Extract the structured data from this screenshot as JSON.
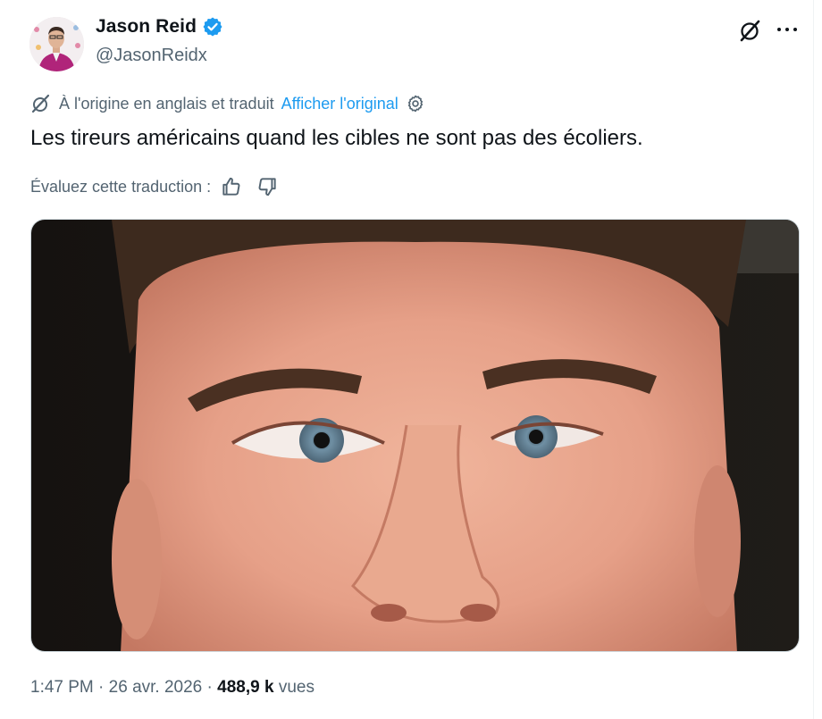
{
  "author": {
    "name": "Jason Reid",
    "handle": "@JasonReidx",
    "verified": true,
    "verified_color": "#1d9bf0"
  },
  "translation": {
    "notice": "À l'origine en anglais et traduit",
    "show_original": "Afficher l'original",
    "rate_label": "Évaluez cette traduction :"
  },
  "tweet": {
    "text": "Les tireurs américains quand les cibles ne sont pas des écoliers."
  },
  "meta": {
    "time": "1:47 PM",
    "separator": " · ",
    "date": "26 avr. 2026",
    "views_count": "488,9 k",
    "views_label": "vues"
  },
  "icons": {
    "verified": "verified-badge-icon",
    "grok": "grok-icon",
    "more": "more-icon",
    "settings": "gear-icon",
    "thumbs_up": "thumbs-up-icon",
    "thumbs_down": "thumbs-down-icon"
  },
  "colors": {
    "text": "#0f1419",
    "secondary": "#536471",
    "link": "#1d9bf0"
  }
}
